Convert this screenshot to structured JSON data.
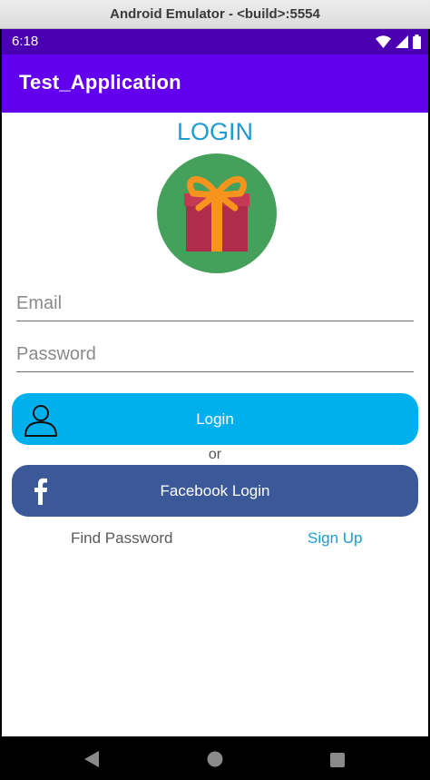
{
  "window": {
    "title": "Android Emulator - <build>:5554"
  },
  "status_bar": {
    "time": "6:18",
    "icons": [
      "wifi-icon",
      "signal-icon",
      "battery-icon"
    ]
  },
  "app_bar": {
    "title": "Test_Application",
    "color": "#6200ee"
  },
  "login_screen": {
    "heading": "LOGIN",
    "logo": "gift-icon",
    "email": {
      "placeholder": "Email",
      "value": ""
    },
    "password": {
      "placeholder": "Password",
      "value": ""
    },
    "login_button": {
      "label": "Login",
      "icon": "user-icon",
      "color": "#00b0ec"
    },
    "separator": "or",
    "facebook_button": {
      "label": "Facebook Login",
      "icon": "facebook-icon",
      "color": "#3b5998"
    },
    "find_password_link": "Find Password",
    "sign_up_link": "Sign Up"
  },
  "nav_bar": {
    "buttons": [
      "back-icon",
      "home-icon",
      "recents-icon"
    ]
  }
}
